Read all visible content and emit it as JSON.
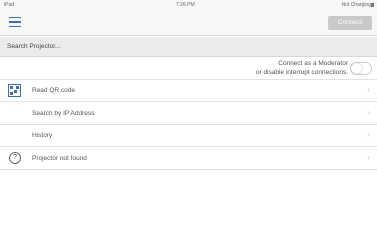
{
  "status_bar": {
    "carrier": "iPad",
    "time": "7:26 PM",
    "battery": "Not Charging"
  },
  "nav": {
    "connect_label": "Connect"
  },
  "search": {
    "placeholder": "Search Projector..."
  },
  "moderator": {
    "line1": "Connect as a Moderator",
    "line2": "or disable interrupt connections.",
    "toggle_on": false
  },
  "rows": [
    {
      "label": "Read QR code",
      "icon": "qr-code-icon"
    },
    {
      "label": "Search by IP Address",
      "icon": ""
    },
    {
      "label": "History",
      "icon": ""
    },
    {
      "label": "Projector not found",
      "icon": "help-icon"
    }
  ],
  "colors": {
    "accent": "#3e6db6",
    "button_disabled": "#c9c9c9"
  }
}
